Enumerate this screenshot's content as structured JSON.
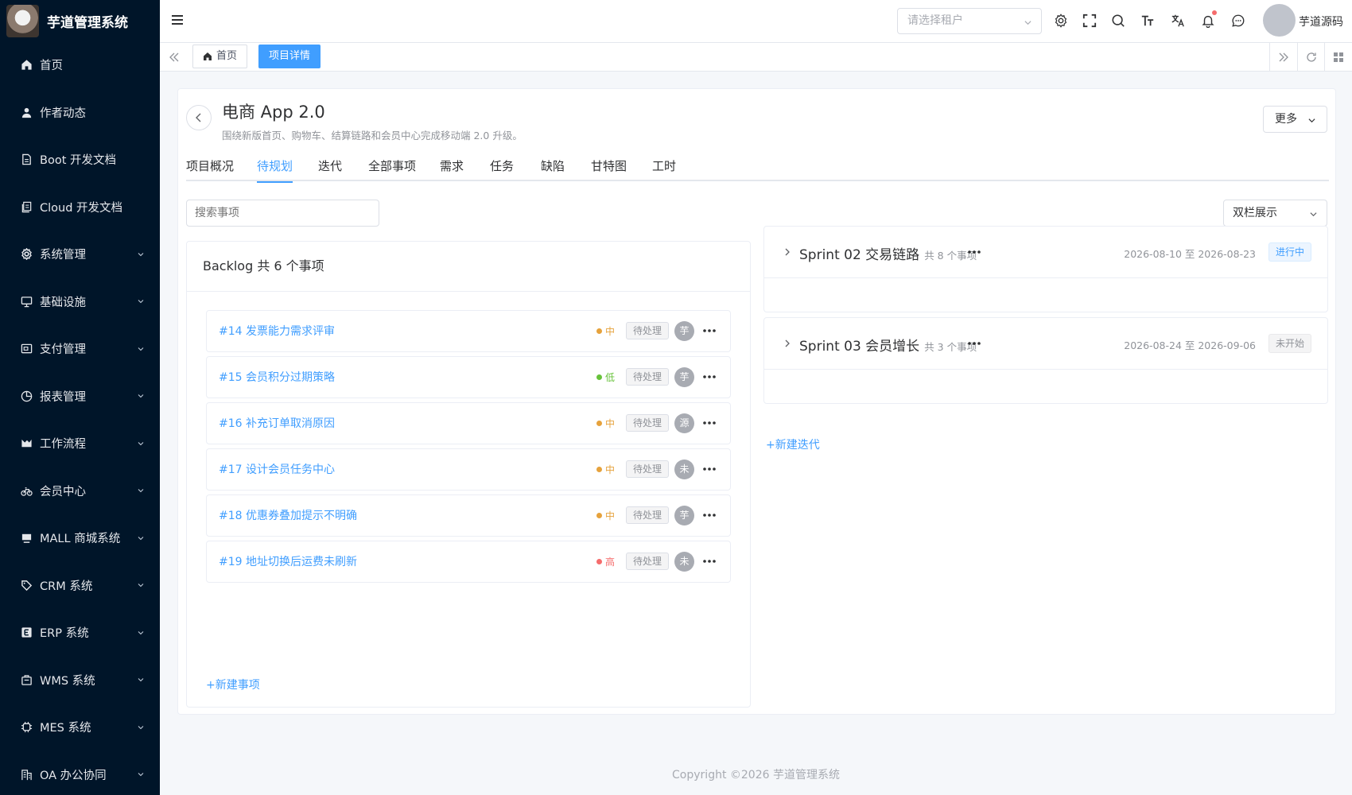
{
  "app": {
    "title": "芋道管理系统"
  },
  "sidebar": {
    "items": [
      {
        "label": "首页",
        "icon": "home-icon",
        "expandable": false
      },
      {
        "label": "作者动态",
        "icon": "user-icon",
        "expandable": false
      },
      {
        "label": "Boot 开发文档",
        "icon": "document-icon",
        "expandable": false
      },
      {
        "label": "Cloud 开发文档",
        "icon": "documents-icon",
        "expandable": false
      },
      {
        "label": "系统管理",
        "icon": "gear-icon",
        "expandable": true
      },
      {
        "label": "基础设施",
        "icon": "monitor-icon",
        "expandable": true
      },
      {
        "label": "支付管理",
        "icon": "payment-icon",
        "expandable": true
      },
      {
        "label": "报表管理",
        "icon": "pie-chart-icon",
        "expandable": true
      },
      {
        "label": "工作流程",
        "icon": "workflow-icon",
        "expandable": true
      },
      {
        "label": "会员中心",
        "icon": "bike-icon",
        "expandable": true
      },
      {
        "label": "MALL 商城系统",
        "icon": "shop-icon",
        "expandable": true
      },
      {
        "label": "CRM 系统",
        "icon": "tag-icon",
        "expandable": true
      },
      {
        "label": "ERP 系统",
        "icon": "erp-icon",
        "expandable": true
      },
      {
        "label": "WMS 系统",
        "icon": "warehouse-icon",
        "expandable": true
      },
      {
        "label": "MES 系统",
        "icon": "chip-icon",
        "expandable": true
      },
      {
        "label": "OA 办公协同",
        "icon": "office-icon",
        "expandable": true
      }
    ]
  },
  "header": {
    "tenant_placeholder": "请选择租户",
    "username": "芋道源码"
  },
  "tags": {
    "home": "首页",
    "current": "项目详情"
  },
  "project": {
    "title": "电商 App 2.0",
    "description": "围绕新版首页、购物车、结算链路和会员中心完成移动端 2.0 升级。",
    "more_label": "更多"
  },
  "tabs": [
    {
      "label": "项目概况",
      "active": false
    },
    {
      "label": "待规划",
      "active": true
    },
    {
      "label": "迭代",
      "active": false
    },
    {
      "label": "全部事项",
      "active": false
    },
    {
      "label": "需求",
      "active": false
    },
    {
      "label": "任务",
      "active": false
    },
    {
      "label": "缺陷",
      "active": false
    },
    {
      "label": "甘特图",
      "active": false
    },
    {
      "label": "工时",
      "active": false
    }
  ],
  "toolbar": {
    "search_placeholder": "搜索事项",
    "layout_value": "双栏展示"
  },
  "backlog": {
    "title": "Backlog 共 6 个事项",
    "new_issue_label": "+新建事项",
    "issues": [
      {
        "title": "#14 发票能力需求评审",
        "priority": "中",
        "priority_color": "#e6a23c",
        "status": "待处理",
        "assignee": "芋"
      },
      {
        "title": "#15 会员积分过期策略",
        "priority": "低",
        "priority_color": "#67c23a",
        "status": "待处理",
        "assignee": "芋"
      },
      {
        "title": "#16 补充订单取消原因",
        "priority": "中",
        "priority_color": "#e6a23c",
        "status": "待处理",
        "assignee": "源"
      },
      {
        "title": "#17 设计会员任务中心",
        "priority": "中",
        "priority_color": "#e6a23c",
        "status": "待处理",
        "assignee": "未"
      },
      {
        "title": "#18 优惠券叠加提示不明确",
        "priority": "中",
        "priority_color": "#e6a23c",
        "status": "待处理",
        "assignee": "芋"
      },
      {
        "title": "#19 地址切换后运费未刷新",
        "priority": "高",
        "priority_color": "#f56c6c",
        "status": "待处理",
        "assignee": "未"
      }
    ]
  },
  "sprints": [
    {
      "name": "Sprint 02 交易链路",
      "count": "共 8 个事项",
      "date": "2026-08-10 至 2026-08-23",
      "status": "进行中",
      "status_kind": "running"
    },
    {
      "name": "Sprint 03 会员增长",
      "count": "共 3 个事项",
      "date": "2026-08-24 至 2026-09-06",
      "status": "未开始",
      "status_kind": "pending"
    }
  ],
  "new_sprint_label": "+新建迭代",
  "footer": {
    "copyright": "Copyright ©2026 芋道管理系统"
  },
  "colors": {
    "sidebar_bg": "#001529",
    "primary": "#409eff"
  }
}
